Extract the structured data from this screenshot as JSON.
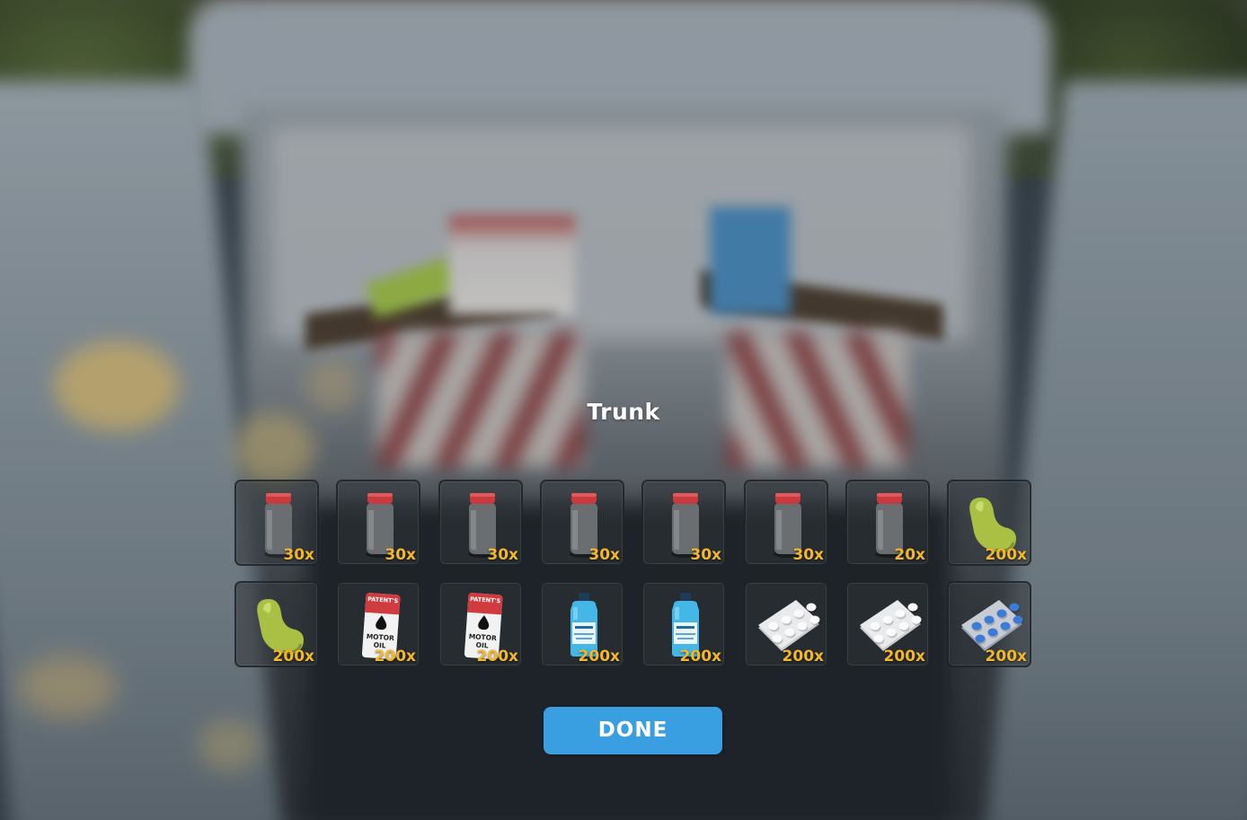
{
  "window": {
    "title": "Trunk"
  },
  "inventory": {
    "slots": [
      {
        "item_icon": "jar-icon",
        "quantity": "30x"
      },
      {
        "item_icon": "jar-icon",
        "quantity": "30x"
      },
      {
        "item_icon": "jar-icon",
        "quantity": "30x"
      },
      {
        "item_icon": "jar-icon",
        "quantity": "30x"
      },
      {
        "item_icon": "jar-icon",
        "quantity": "30x"
      },
      {
        "item_icon": "jar-icon",
        "quantity": "30x"
      },
      {
        "item_icon": "jar-icon",
        "quantity": "20x"
      },
      {
        "item_icon": "bean-icon",
        "quantity": "200x"
      },
      {
        "item_icon": "bean-icon",
        "quantity": "200x"
      },
      {
        "item_icon": "motor-oil-icon",
        "quantity": "200x"
      },
      {
        "item_icon": "motor-oil-icon",
        "quantity": "200x"
      },
      {
        "item_icon": "blue-bottle-icon",
        "quantity": "200x"
      },
      {
        "item_icon": "blue-bottle-icon",
        "quantity": "200x"
      },
      {
        "item_icon": "white-pill-pack-icon",
        "quantity": "200x"
      },
      {
        "item_icon": "white-pill-pack-icon",
        "quantity": "200x"
      },
      {
        "item_icon": "blue-pill-pack-icon",
        "quantity": "200x"
      }
    ]
  },
  "motor_oil_label": {
    "brand": "PATENT'S",
    "line1": "MOTOR",
    "line2": "OIL"
  },
  "done_button": {
    "label": "DONE"
  },
  "colors": {
    "accent": "#3a9fe0",
    "quantity": "#f2b72a",
    "title": "#ffffff"
  }
}
